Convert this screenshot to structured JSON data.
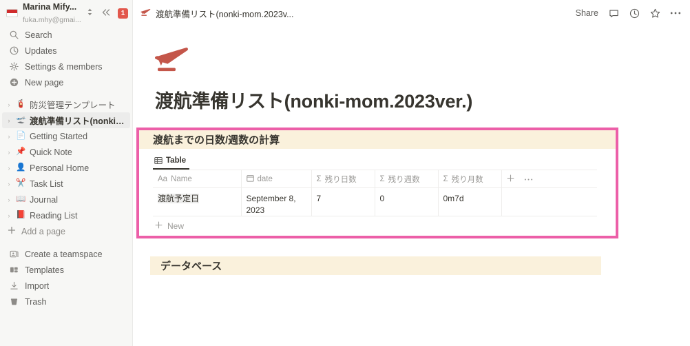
{
  "sidebar": {
    "account": {
      "name": "Marina Mify...",
      "email": "fuka.mhy@gmai...",
      "flag_icon": "indonesia-flag-icon",
      "switcher_icon": "chevron-up-down-icon",
      "collapse_icon": "double-chevron-left-icon",
      "notification_count": "1"
    },
    "nav": [
      {
        "label": "Search",
        "icon": "search-icon"
      },
      {
        "label": "Updates",
        "icon": "clock-icon"
      },
      {
        "label": "Settings & members",
        "icon": "gear-icon"
      },
      {
        "label": "New page",
        "icon": "plus-circle-icon"
      }
    ],
    "pages": [
      {
        "label": "防災管理テンプレート",
        "emoji": "🧯",
        "selected": false
      },
      {
        "label": "渡航準備リスト(nonki-m...",
        "emoji": "🛫",
        "selected": true
      },
      {
        "label": "Getting Started",
        "emoji": "📄",
        "selected": false
      },
      {
        "label": "Quick Note",
        "emoji": "📌",
        "selected": false
      },
      {
        "label": "Personal Home",
        "emoji": "👤",
        "selected": false
      },
      {
        "label": "Task List",
        "emoji": "✂️",
        "selected": false
      },
      {
        "label": "Journal",
        "emoji": "📖",
        "selected": false
      },
      {
        "label": "Reading List",
        "emoji": "📕",
        "selected": false
      }
    ],
    "add_page": {
      "label": "Add a page",
      "icon": "plus-icon"
    },
    "bottom": [
      {
        "label": "Create a teamspace",
        "icon": "teamspace-icon"
      },
      {
        "label": "Templates",
        "icon": "templates-icon"
      },
      {
        "label": "Import",
        "icon": "import-download-icon"
      },
      {
        "label": "Trash",
        "icon": "trash-icon"
      }
    ]
  },
  "topbar": {
    "breadcrumb": "渡航準備リスト(nonki-mom.2023v...",
    "breadcrumb_icon": "airplane-icon",
    "share_label": "Share",
    "comment_icon": "comment-icon",
    "updates_icon": "clock-icon",
    "favorite_icon": "star-icon",
    "more_icon": "more-horizontal-icon"
  },
  "page": {
    "icon": "airplane-departure-icon",
    "title": "渡航準備リスト(nonki-mom.2023ver.)"
  },
  "callout": {
    "heading": "渡航までの日数/週数の計算"
  },
  "database": {
    "view_tab": {
      "label": "Table",
      "icon": "table-icon"
    },
    "columns": [
      {
        "label": "Name",
        "type_icon": "Aa",
        "align": "left"
      },
      {
        "label": "date",
        "type_icon": "calendar-icon",
        "align": "left"
      },
      {
        "label": "残り日数",
        "type_icon": "Σ",
        "align": "right"
      },
      {
        "label": "残り週数",
        "type_icon": "Σ",
        "align": "right"
      },
      {
        "label": "残り月数",
        "type_icon": "Σ",
        "align": "left"
      }
    ],
    "add_column_icon": "plus-icon",
    "column_options_icon": "more-horizontal-icon",
    "rows": [
      {
        "name": "渡航予定日",
        "date": "September 8, 2023",
        "days_left": "7",
        "weeks_left": "0",
        "months_left": "0m7d"
      }
    ],
    "new_row": {
      "label": "New",
      "icon": "plus-icon"
    }
  },
  "callout2": {
    "heading": "データベース"
  },
  "colors": {
    "accent_pink": "#ec5fa8",
    "callout_bg": "#faf1dc",
    "sidebar_bg": "#f7f7f5",
    "badge_red": "#e2574c",
    "icon_red": "#c4564a"
  }
}
